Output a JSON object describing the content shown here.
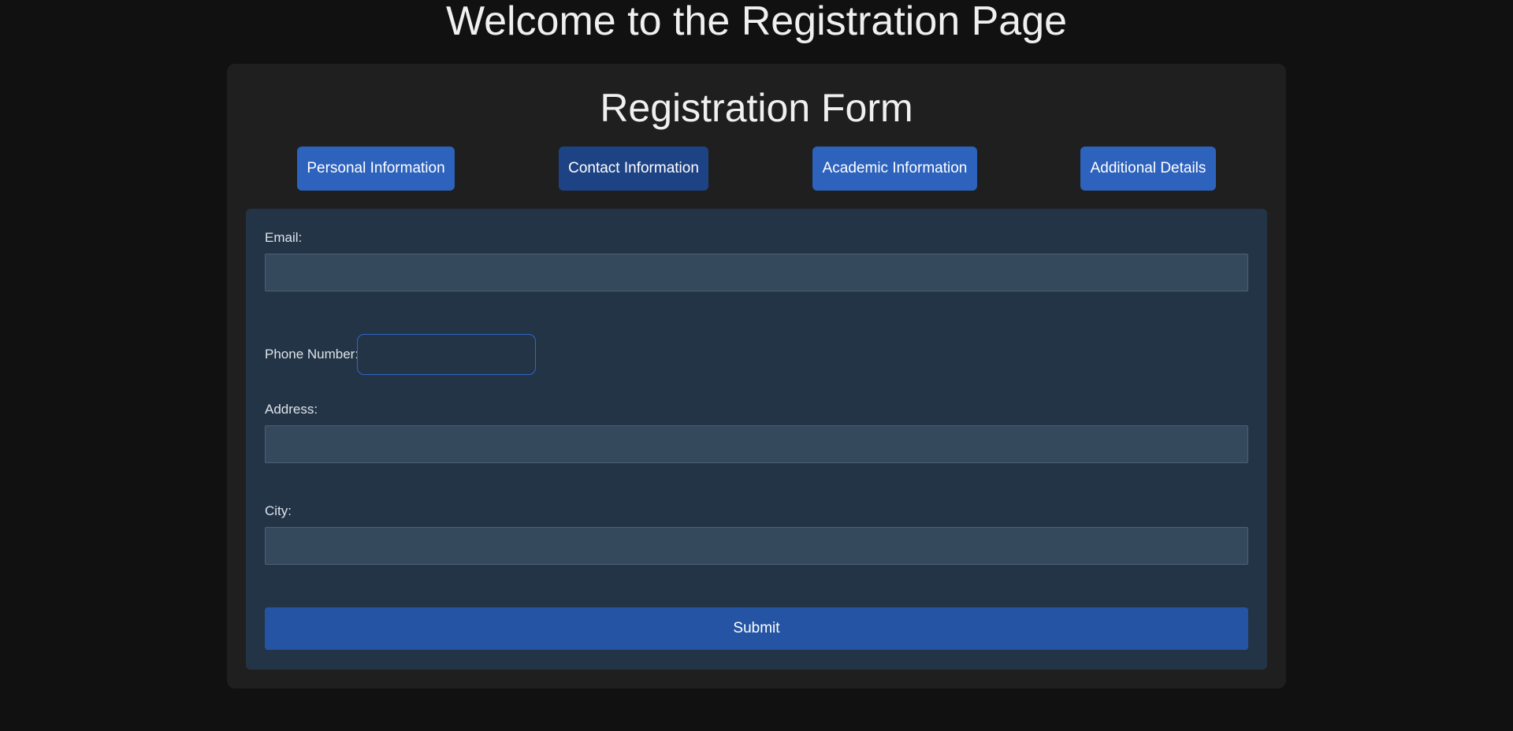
{
  "page": {
    "title": "Welcome to the Registration Page"
  },
  "form": {
    "title": "Registration Form",
    "tabs": [
      {
        "label": "Personal Information",
        "active": false
      },
      {
        "label": "Contact Information",
        "active": true
      },
      {
        "label": "Academic Information",
        "active": false
      },
      {
        "label": "Additional Details",
        "active": false
      }
    ],
    "fields": {
      "email": {
        "label": "Email:",
        "value": ""
      },
      "phone": {
        "label": "Phone Number:",
        "value": ""
      },
      "address": {
        "label": "Address:",
        "value": ""
      },
      "city": {
        "label": "City:",
        "value": ""
      }
    },
    "submit_label": "Submit"
  },
  "colors": {
    "background": "#111111",
    "card": "#1f1f1f",
    "panel": "#243447",
    "tab": "#2d62bd",
    "tab_active": "#1e4385",
    "submit": "#2454a3"
  }
}
